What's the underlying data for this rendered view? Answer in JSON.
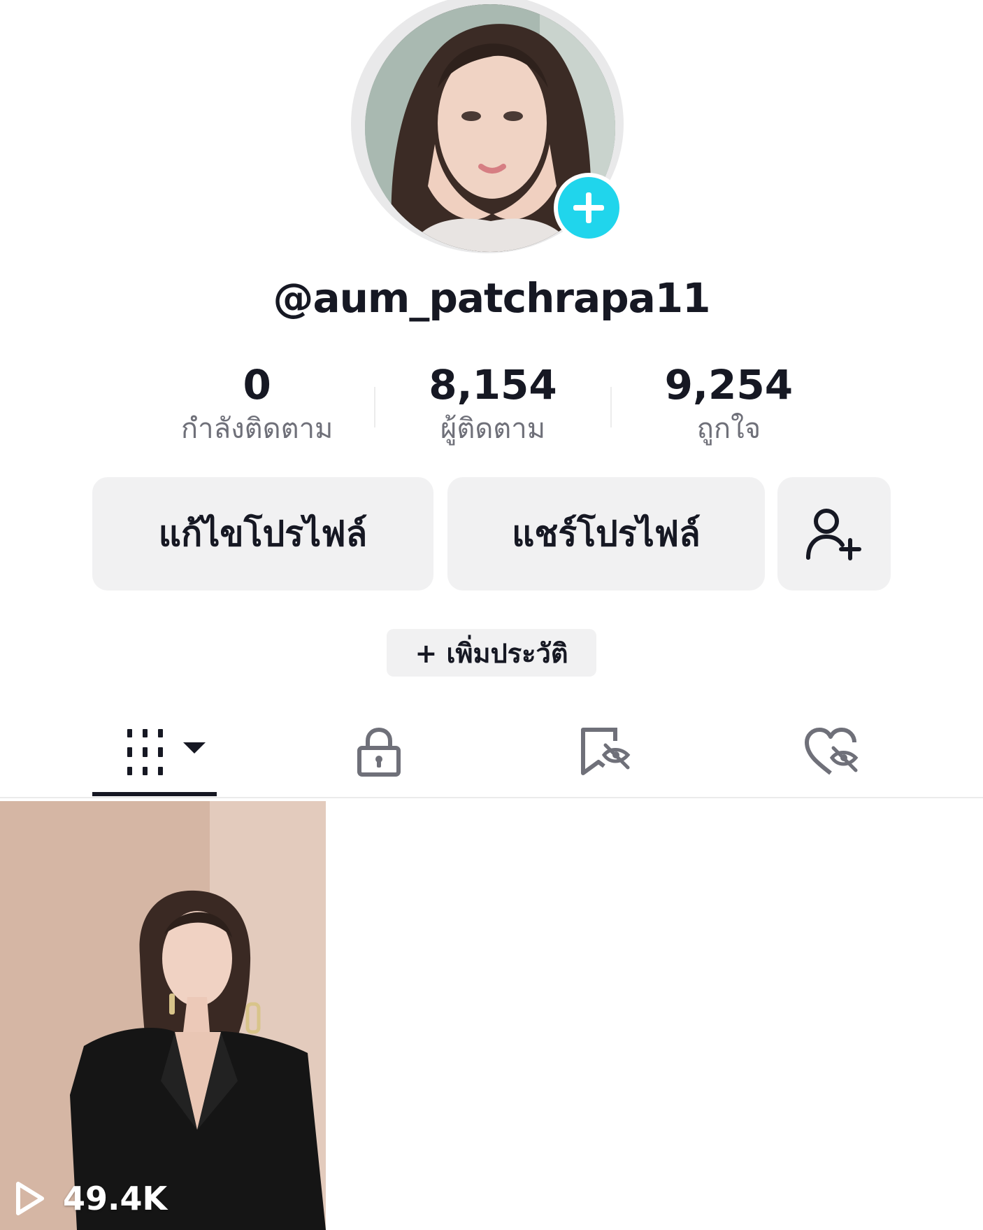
{
  "profile": {
    "username": "@aum_patchrapa11",
    "avatar_add_icon": "plus-icon"
  },
  "stats": [
    {
      "value": "0",
      "label": "กำลังติดตาม"
    },
    {
      "value": "8,154",
      "label": "ผู้ติดตาม"
    },
    {
      "value": "9,254",
      "label": "ถูกใจ"
    }
  ],
  "actions": {
    "edit_label": "แก้ไขโปรไฟล์",
    "share_label": "แชร์โปรไฟล์",
    "add_friend_icon": "add-friend-icon"
  },
  "bio": {
    "add_label": "+ เพิ่มประวัติ"
  },
  "tabs": [
    {
      "name": "videos",
      "icon": "grid-icon",
      "selected": true
    },
    {
      "name": "private",
      "icon": "lock-icon",
      "selected": false
    },
    {
      "name": "saved",
      "icon": "bookmark-hidden-icon",
      "selected": false
    },
    {
      "name": "liked",
      "icon": "heart-hidden-icon",
      "selected": false
    }
  ],
  "videos": [
    {
      "views": "49.4K",
      "icon": "play-icon"
    }
  ],
  "colors": {
    "accent": "#20d5ec",
    "text": "#161823",
    "muted": "#6f7079",
    "button_bg": "#f1f1f2"
  }
}
